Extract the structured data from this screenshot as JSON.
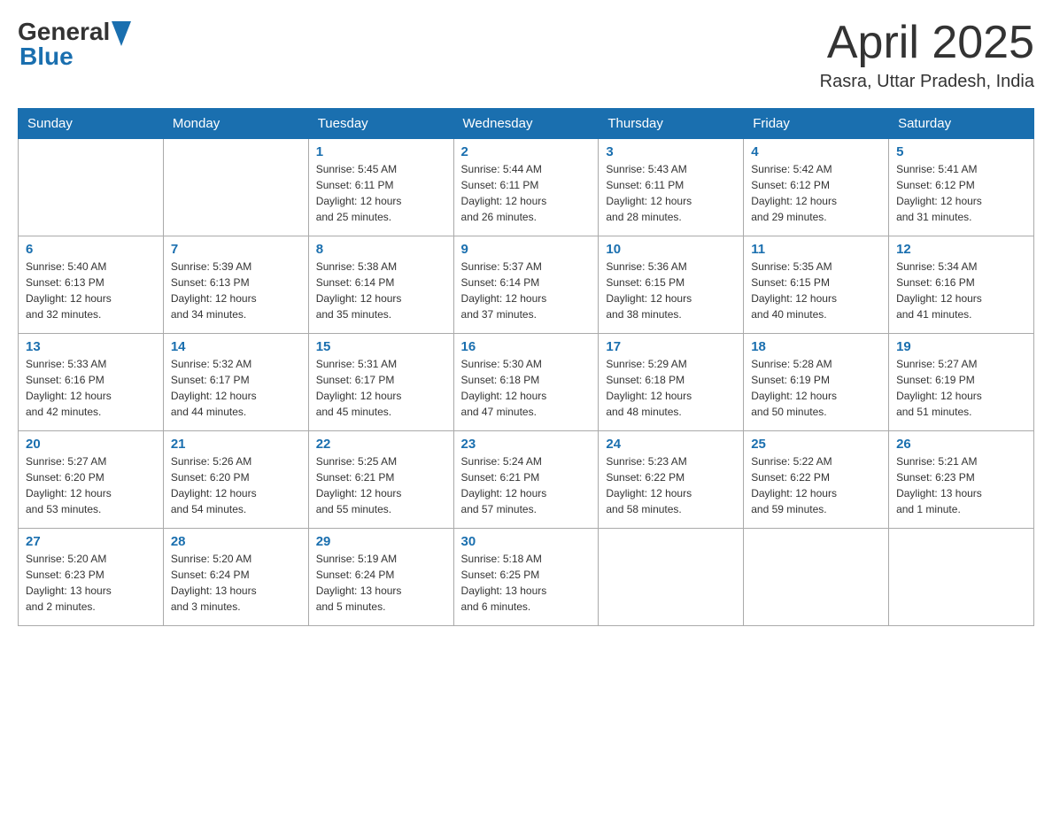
{
  "header": {
    "logo_general": "General",
    "logo_blue": "Blue",
    "title": "April 2025",
    "subtitle": "Rasra, Uttar Pradesh, India"
  },
  "days_of_week": [
    "Sunday",
    "Monday",
    "Tuesday",
    "Wednesday",
    "Thursday",
    "Friday",
    "Saturday"
  ],
  "weeks": [
    [
      {
        "day": "",
        "info": ""
      },
      {
        "day": "",
        "info": ""
      },
      {
        "day": "1",
        "info": "Sunrise: 5:45 AM\nSunset: 6:11 PM\nDaylight: 12 hours\nand 25 minutes."
      },
      {
        "day": "2",
        "info": "Sunrise: 5:44 AM\nSunset: 6:11 PM\nDaylight: 12 hours\nand 26 minutes."
      },
      {
        "day": "3",
        "info": "Sunrise: 5:43 AM\nSunset: 6:11 PM\nDaylight: 12 hours\nand 28 minutes."
      },
      {
        "day": "4",
        "info": "Sunrise: 5:42 AM\nSunset: 6:12 PM\nDaylight: 12 hours\nand 29 minutes."
      },
      {
        "day": "5",
        "info": "Sunrise: 5:41 AM\nSunset: 6:12 PM\nDaylight: 12 hours\nand 31 minutes."
      }
    ],
    [
      {
        "day": "6",
        "info": "Sunrise: 5:40 AM\nSunset: 6:13 PM\nDaylight: 12 hours\nand 32 minutes."
      },
      {
        "day": "7",
        "info": "Sunrise: 5:39 AM\nSunset: 6:13 PM\nDaylight: 12 hours\nand 34 minutes."
      },
      {
        "day": "8",
        "info": "Sunrise: 5:38 AM\nSunset: 6:14 PM\nDaylight: 12 hours\nand 35 minutes."
      },
      {
        "day": "9",
        "info": "Sunrise: 5:37 AM\nSunset: 6:14 PM\nDaylight: 12 hours\nand 37 minutes."
      },
      {
        "day": "10",
        "info": "Sunrise: 5:36 AM\nSunset: 6:15 PM\nDaylight: 12 hours\nand 38 minutes."
      },
      {
        "day": "11",
        "info": "Sunrise: 5:35 AM\nSunset: 6:15 PM\nDaylight: 12 hours\nand 40 minutes."
      },
      {
        "day": "12",
        "info": "Sunrise: 5:34 AM\nSunset: 6:16 PM\nDaylight: 12 hours\nand 41 minutes."
      }
    ],
    [
      {
        "day": "13",
        "info": "Sunrise: 5:33 AM\nSunset: 6:16 PM\nDaylight: 12 hours\nand 42 minutes."
      },
      {
        "day": "14",
        "info": "Sunrise: 5:32 AM\nSunset: 6:17 PM\nDaylight: 12 hours\nand 44 minutes."
      },
      {
        "day": "15",
        "info": "Sunrise: 5:31 AM\nSunset: 6:17 PM\nDaylight: 12 hours\nand 45 minutes."
      },
      {
        "day": "16",
        "info": "Sunrise: 5:30 AM\nSunset: 6:18 PM\nDaylight: 12 hours\nand 47 minutes."
      },
      {
        "day": "17",
        "info": "Sunrise: 5:29 AM\nSunset: 6:18 PM\nDaylight: 12 hours\nand 48 minutes."
      },
      {
        "day": "18",
        "info": "Sunrise: 5:28 AM\nSunset: 6:19 PM\nDaylight: 12 hours\nand 50 minutes."
      },
      {
        "day": "19",
        "info": "Sunrise: 5:27 AM\nSunset: 6:19 PM\nDaylight: 12 hours\nand 51 minutes."
      }
    ],
    [
      {
        "day": "20",
        "info": "Sunrise: 5:27 AM\nSunset: 6:20 PM\nDaylight: 12 hours\nand 53 minutes."
      },
      {
        "day": "21",
        "info": "Sunrise: 5:26 AM\nSunset: 6:20 PM\nDaylight: 12 hours\nand 54 minutes."
      },
      {
        "day": "22",
        "info": "Sunrise: 5:25 AM\nSunset: 6:21 PM\nDaylight: 12 hours\nand 55 minutes."
      },
      {
        "day": "23",
        "info": "Sunrise: 5:24 AM\nSunset: 6:21 PM\nDaylight: 12 hours\nand 57 minutes."
      },
      {
        "day": "24",
        "info": "Sunrise: 5:23 AM\nSunset: 6:22 PM\nDaylight: 12 hours\nand 58 minutes."
      },
      {
        "day": "25",
        "info": "Sunrise: 5:22 AM\nSunset: 6:22 PM\nDaylight: 12 hours\nand 59 minutes."
      },
      {
        "day": "26",
        "info": "Sunrise: 5:21 AM\nSunset: 6:23 PM\nDaylight: 13 hours\nand 1 minute."
      }
    ],
    [
      {
        "day": "27",
        "info": "Sunrise: 5:20 AM\nSunset: 6:23 PM\nDaylight: 13 hours\nand 2 minutes."
      },
      {
        "day": "28",
        "info": "Sunrise: 5:20 AM\nSunset: 6:24 PM\nDaylight: 13 hours\nand 3 minutes."
      },
      {
        "day": "29",
        "info": "Sunrise: 5:19 AM\nSunset: 6:24 PM\nDaylight: 13 hours\nand 5 minutes."
      },
      {
        "day": "30",
        "info": "Sunrise: 5:18 AM\nSunset: 6:25 PM\nDaylight: 13 hours\nand 6 minutes."
      },
      {
        "day": "",
        "info": ""
      },
      {
        "day": "",
        "info": ""
      },
      {
        "day": "",
        "info": ""
      }
    ]
  ]
}
